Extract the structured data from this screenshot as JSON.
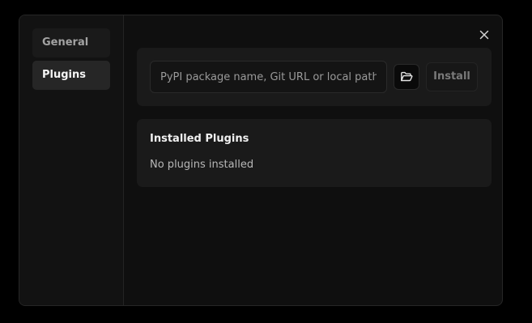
{
  "sidebar": {
    "items": [
      {
        "label": "General",
        "active": false
      },
      {
        "label": "Plugins",
        "active": true
      }
    ]
  },
  "install": {
    "placeholder": "PyPI package name, Git URL or local path",
    "value": "",
    "folder_icon": "folder-open-icon",
    "install_label": "Install"
  },
  "installed": {
    "title": "Installed Plugins",
    "empty_text": "No plugins installed"
  },
  "icons": {
    "close": "close-icon"
  },
  "colors": {
    "background": "#000000",
    "dialog": "#0f0f0f",
    "panel": "#1a1a1a",
    "active_nav": "#262626"
  }
}
